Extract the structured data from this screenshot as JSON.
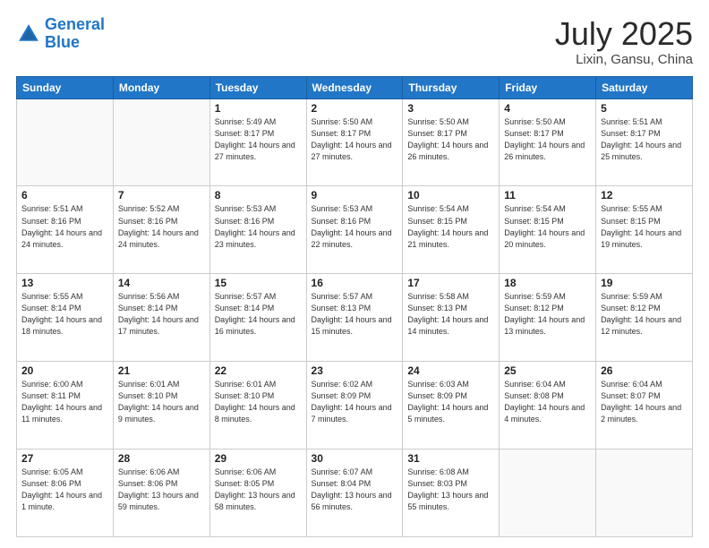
{
  "logo": {
    "line1": "General",
    "line2": "Blue"
  },
  "title": "July 2025",
  "location": "Lixin, Gansu, China",
  "days_header": [
    "Sunday",
    "Monday",
    "Tuesday",
    "Wednesday",
    "Thursday",
    "Friday",
    "Saturday"
  ],
  "weeks": [
    [
      {
        "day": "",
        "info": ""
      },
      {
        "day": "",
        "info": ""
      },
      {
        "day": "1",
        "info": "Sunrise: 5:49 AM\nSunset: 8:17 PM\nDaylight: 14 hours and 27 minutes."
      },
      {
        "day": "2",
        "info": "Sunrise: 5:50 AM\nSunset: 8:17 PM\nDaylight: 14 hours and 27 minutes."
      },
      {
        "day": "3",
        "info": "Sunrise: 5:50 AM\nSunset: 8:17 PM\nDaylight: 14 hours and 26 minutes."
      },
      {
        "day": "4",
        "info": "Sunrise: 5:50 AM\nSunset: 8:17 PM\nDaylight: 14 hours and 26 minutes."
      },
      {
        "day": "5",
        "info": "Sunrise: 5:51 AM\nSunset: 8:17 PM\nDaylight: 14 hours and 25 minutes."
      }
    ],
    [
      {
        "day": "6",
        "info": "Sunrise: 5:51 AM\nSunset: 8:16 PM\nDaylight: 14 hours and 24 minutes."
      },
      {
        "day": "7",
        "info": "Sunrise: 5:52 AM\nSunset: 8:16 PM\nDaylight: 14 hours and 24 minutes."
      },
      {
        "day": "8",
        "info": "Sunrise: 5:53 AM\nSunset: 8:16 PM\nDaylight: 14 hours and 23 minutes."
      },
      {
        "day": "9",
        "info": "Sunrise: 5:53 AM\nSunset: 8:16 PM\nDaylight: 14 hours and 22 minutes."
      },
      {
        "day": "10",
        "info": "Sunrise: 5:54 AM\nSunset: 8:15 PM\nDaylight: 14 hours and 21 minutes."
      },
      {
        "day": "11",
        "info": "Sunrise: 5:54 AM\nSunset: 8:15 PM\nDaylight: 14 hours and 20 minutes."
      },
      {
        "day": "12",
        "info": "Sunrise: 5:55 AM\nSunset: 8:15 PM\nDaylight: 14 hours and 19 minutes."
      }
    ],
    [
      {
        "day": "13",
        "info": "Sunrise: 5:55 AM\nSunset: 8:14 PM\nDaylight: 14 hours and 18 minutes."
      },
      {
        "day": "14",
        "info": "Sunrise: 5:56 AM\nSunset: 8:14 PM\nDaylight: 14 hours and 17 minutes."
      },
      {
        "day": "15",
        "info": "Sunrise: 5:57 AM\nSunset: 8:14 PM\nDaylight: 14 hours and 16 minutes."
      },
      {
        "day": "16",
        "info": "Sunrise: 5:57 AM\nSunset: 8:13 PM\nDaylight: 14 hours and 15 minutes."
      },
      {
        "day": "17",
        "info": "Sunrise: 5:58 AM\nSunset: 8:13 PM\nDaylight: 14 hours and 14 minutes."
      },
      {
        "day": "18",
        "info": "Sunrise: 5:59 AM\nSunset: 8:12 PM\nDaylight: 14 hours and 13 minutes."
      },
      {
        "day": "19",
        "info": "Sunrise: 5:59 AM\nSunset: 8:12 PM\nDaylight: 14 hours and 12 minutes."
      }
    ],
    [
      {
        "day": "20",
        "info": "Sunrise: 6:00 AM\nSunset: 8:11 PM\nDaylight: 14 hours and 11 minutes."
      },
      {
        "day": "21",
        "info": "Sunrise: 6:01 AM\nSunset: 8:10 PM\nDaylight: 14 hours and 9 minutes."
      },
      {
        "day": "22",
        "info": "Sunrise: 6:01 AM\nSunset: 8:10 PM\nDaylight: 14 hours and 8 minutes."
      },
      {
        "day": "23",
        "info": "Sunrise: 6:02 AM\nSunset: 8:09 PM\nDaylight: 14 hours and 7 minutes."
      },
      {
        "day": "24",
        "info": "Sunrise: 6:03 AM\nSunset: 8:09 PM\nDaylight: 14 hours and 5 minutes."
      },
      {
        "day": "25",
        "info": "Sunrise: 6:04 AM\nSunset: 8:08 PM\nDaylight: 14 hours and 4 minutes."
      },
      {
        "day": "26",
        "info": "Sunrise: 6:04 AM\nSunset: 8:07 PM\nDaylight: 14 hours and 2 minutes."
      }
    ],
    [
      {
        "day": "27",
        "info": "Sunrise: 6:05 AM\nSunset: 8:06 PM\nDaylight: 14 hours and 1 minute."
      },
      {
        "day": "28",
        "info": "Sunrise: 6:06 AM\nSunset: 8:06 PM\nDaylight: 13 hours and 59 minutes."
      },
      {
        "day": "29",
        "info": "Sunrise: 6:06 AM\nSunset: 8:05 PM\nDaylight: 13 hours and 58 minutes."
      },
      {
        "day": "30",
        "info": "Sunrise: 6:07 AM\nSunset: 8:04 PM\nDaylight: 13 hours and 56 minutes."
      },
      {
        "day": "31",
        "info": "Sunrise: 6:08 AM\nSunset: 8:03 PM\nDaylight: 13 hours and 55 minutes."
      },
      {
        "day": "",
        "info": ""
      },
      {
        "day": "",
        "info": ""
      }
    ]
  ]
}
